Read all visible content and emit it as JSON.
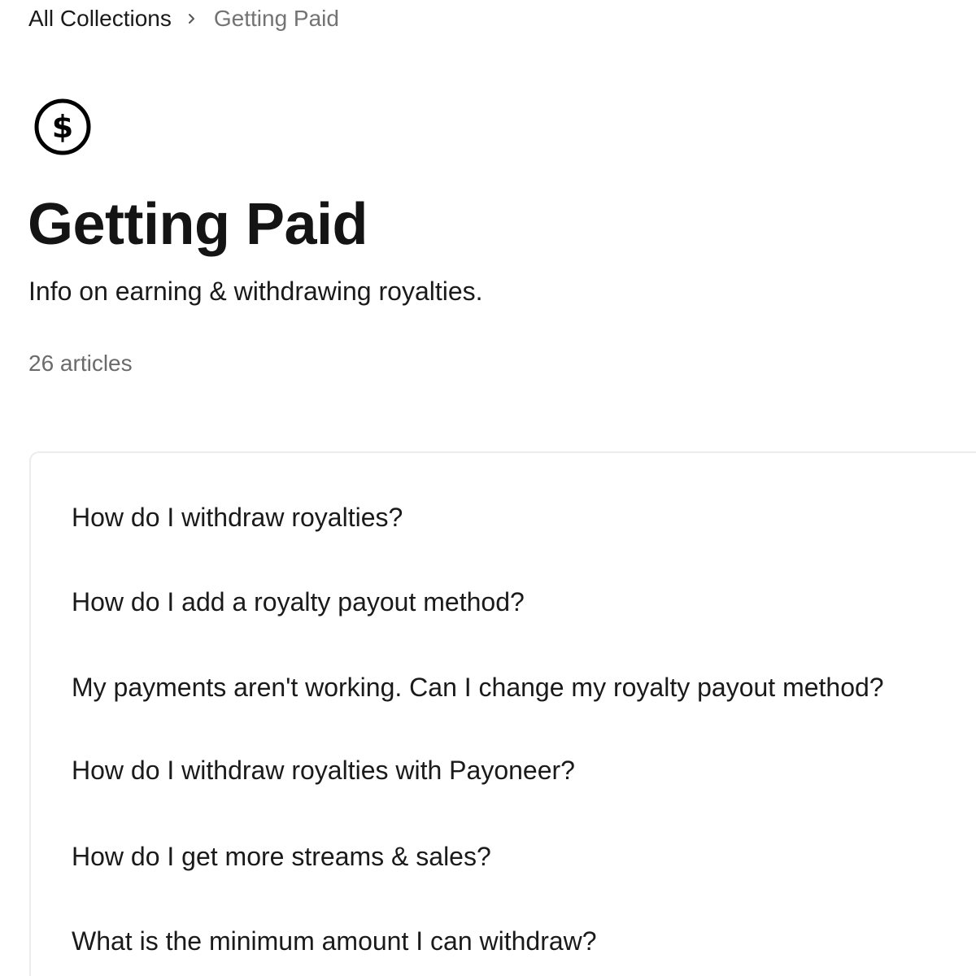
{
  "breadcrumb": {
    "root_label": "All Collections",
    "separator_icon": "chevron-right-icon",
    "current_label": "Getting Paid"
  },
  "collection": {
    "icon": "dollar-circle-icon",
    "title": "Getting Paid",
    "description": "Info on earning & withdrawing royalties.",
    "article_count": "26 articles"
  },
  "articles": [
    "How do I withdraw royalties?",
    "How do I add a royalty payout method?",
    "My payments aren't working. Can I change my royalty payout method?",
    "How do I withdraw royalties with Payoneer?",
    "How do I get more streams & sales?",
    "What is the minimum amount I can withdraw?"
  ]
}
